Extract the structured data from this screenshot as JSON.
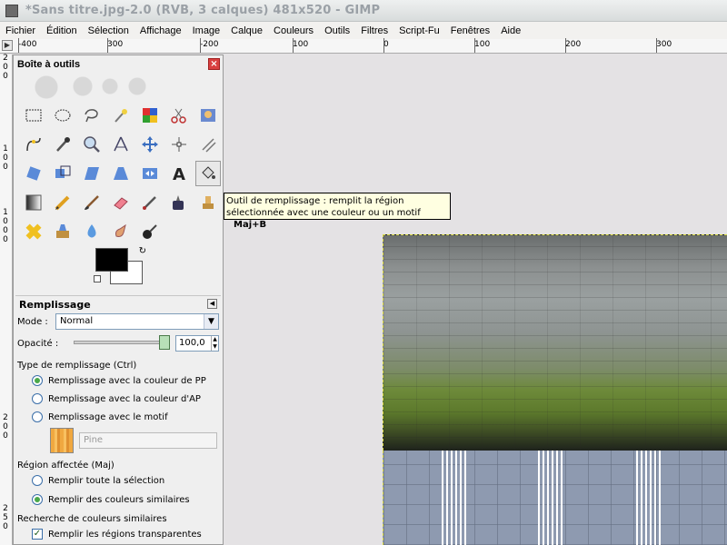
{
  "window": {
    "title": "*Sans titre.jpg-2.0 (RVB, 3 calques) 481x520 - GIMP"
  },
  "menu": [
    "Fichier",
    "Édition",
    "Sélection",
    "Affichage",
    "Image",
    "Calque",
    "Couleurs",
    "Outils",
    "Filtres",
    "Script-Fu",
    "Fenêtres",
    "Aide"
  ],
  "ruler": {
    "top_labels": [
      "-400",
      "300",
      "-200",
      "100",
      "0",
      "100",
      "200",
      "300"
    ],
    "left_labels": [
      "2",
      "0",
      "0",
      "1",
      "0",
      "0",
      "1",
      "0",
      "0",
      "0",
      "2",
      "0",
      "0",
      "2",
      "5",
      "0"
    ]
  },
  "toolbox": {
    "title": "Boîte à outils",
    "close": "×",
    "tools": [
      "rect-select-icon",
      "ellipse-select-icon",
      "lasso-icon",
      "fuzzy-select-icon",
      "select-by-color-icon",
      "scissors-icon",
      "foreground-select-icon",
      "paths-icon",
      "color-picker-icon",
      "zoom-icon",
      "measure-icon",
      "move-icon",
      "align-icon",
      "crop-icon",
      "rotate-icon",
      "scale-icon",
      "shear-icon",
      "perspective-icon",
      "flip-icon",
      "text-icon",
      "bucket-fill-icon",
      "blend-icon",
      "pencil-icon",
      "paintbrush-icon",
      "eraser-icon",
      "airbrush-icon",
      "ink-icon",
      "clone-icon",
      "heal-icon",
      "perspective-clone-icon",
      "blur-icon",
      "smudge-icon",
      "dodge-burn-icon"
    ],
    "active_tool": 20,
    "fg_color": "#000000",
    "bg_color": "#ffffff"
  },
  "options": {
    "title": "Remplissage",
    "mode_label": "Mode :",
    "mode_value": "Normal",
    "opacity_label": "Opacité :",
    "opacity_value": "100,0",
    "fill_type_label": "Type de remplissage (Ctrl)",
    "fill_types": [
      "Remplissage avec la couleur de PP",
      "Remplissage avec la couleur d'AP",
      "Remplissage avec le motif"
    ],
    "fill_type_selected": 0,
    "pattern_name": "Pine",
    "region_label": "Région affectée (Maj)",
    "regions": [
      "Remplir toute la sélection",
      "Remplir des couleurs similaires"
    ],
    "region_selected": 1,
    "search_label": "Recherche de couleurs similaires",
    "transparent_label": "Remplir les régions transparentes",
    "transparent_checked": true
  },
  "tooltip": {
    "line1": "Outil de remplissage : remplit la région",
    "line2": "sélectionnée avec une couleur ou un motif",
    "shortcut": "Maj+B"
  }
}
